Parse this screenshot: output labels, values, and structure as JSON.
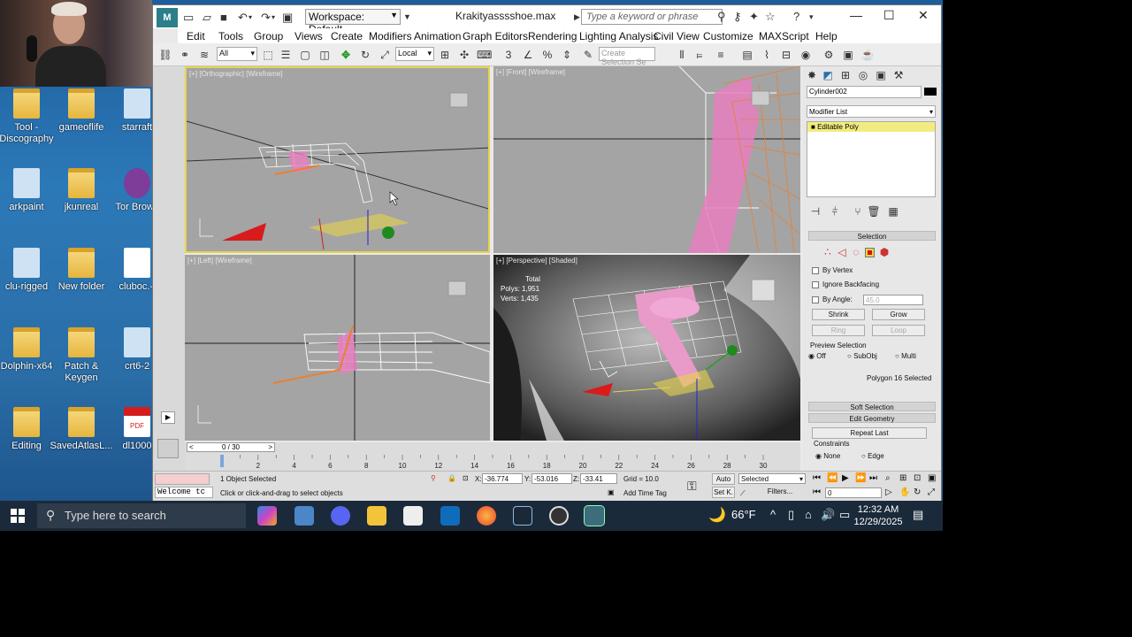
{
  "desktop": {
    "icons": [
      {
        "label": "Tool -\nDiscography",
        "kind": "folder"
      },
      {
        "label": "gameoflife",
        "kind": "folder"
      },
      {
        "label": "starraft",
        "kind": "gen"
      },
      {
        "label": "arkpaint",
        "kind": "gen"
      },
      {
        "label": "jkunreal",
        "kind": "folder"
      },
      {
        "label": "Tor Brows",
        "kind": "tor"
      },
      {
        "label": "clu-rigged",
        "kind": "gen"
      },
      {
        "label": "New folder",
        "kind": "folder"
      },
      {
        "label": "cluboc.-j",
        "kind": "doc"
      },
      {
        "label": "Dolphin-x64",
        "kind": "folder"
      },
      {
        "label": "Patch &\nKeygen",
        "kind": "folder"
      },
      {
        "label": "crt6-2",
        "kind": "gen"
      },
      {
        "label": "Editing",
        "kind": "folder"
      },
      {
        "label": "SavedAtlasL...",
        "kind": "folder"
      },
      {
        "label": "dl1000",
        "kind": "pdf"
      }
    ]
  },
  "app": {
    "title": "Krakityasssshoe.max",
    "workspace": "Workspace: Default",
    "search_placeholder": "Type a keyword or phrase",
    "menu": [
      "Edit",
      "Tools",
      "Group",
      "Views",
      "Create",
      "Modifiers",
      "Animation",
      "Graph Editors",
      "Rendering",
      "Lighting Analysis",
      "Civil View",
      "Customize",
      "MAXScript",
      "Help"
    ],
    "toolbar": {
      "selection_filter": "All",
      "reference_coord": "Local",
      "named_selection": "Create Selection Se"
    },
    "viewports": [
      {
        "label": "[+] [Orthographic] [Wireframe]"
      },
      {
        "label": "[+] [Front] [Wireframe]"
      },
      {
        "label": "[+] [Left] [Wireframe]"
      },
      {
        "label": "[+] [Perspective] [Shaded]",
        "stats": {
          "header": "Total",
          "polys_label": "Polys:",
          "polys": "1,951",
          "verts_label": "Verts:",
          "verts": "1,435"
        }
      }
    ],
    "command_panel": {
      "object_name": "Cylinder002",
      "modifier_list": "Modifier List",
      "stack_item": "Editable Poly",
      "selection_title": "Selection",
      "by_vertex": "By Vertex",
      "ignore_backfacing": "Ignore Backfacing",
      "by_angle": "By Angle:",
      "by_angle_value": "45.0",
      "shrink": "Shrink",
      "grow": "Grow",
      "ring": "Ring",
      "loop": "Loop",
      "preview_selection": "Preview Selection",
      "preview_off": "Off",
      "preview_subobj": "SubObj",
      "preview_multi": "Multi",
      "selected_count": "Polygon 16 Selected",
      "soft_selection": "Soft Selection",
      "edit_geometry": "Edit Geometry",
      "repeat_last": "Repeat Last",
      "constraints": "Constraints",
      "constraint_none": "None",
      "constraint_edge": "Edge"
    },
    "timeline": {
      "frame": "0 / 30",
      "ticks": [
        "0",
        "2",
        "4",
        "6",
        "8",
        "10",
        "12",
        "14",
        "16",
        "18",
        "20",
        "22",
        "24",
        "26",
        "28",
        "30"
      ]
    },
    "status": {
      "maxscript": "Welcome tc",
      "objects_selected": "1 Object Selected",
      "prompt": "Click or click-and-drag to select objects",
      "x_label": "X:",
      "x": "-36.774",
      "y_label": "Y:",
      "y": "-53.016",
      "z_label": "Z:",
      "z": "-33.41",
      "grid": "Grid = 10.0",
      "add_time_tag": "Add Time Tag",
      "auto": "Auto",
      "set_key": "Set K.",
      "key_mode": "Selected",
      "filters": "Filters...",
      "current_frame": "0"
    }
  },
  "taskbar": {
    "search_placeholder": "Type here to search",
    "weather": "66°F",
    "time": "12:32 AM",
    "date": "12/29/2025"
  },
  "colors": {
    "selection_yellow": "#e6d44a",
    "pink_object": "#e87fc0",
    "max_teal": "#2a7f8a"
  }
}
